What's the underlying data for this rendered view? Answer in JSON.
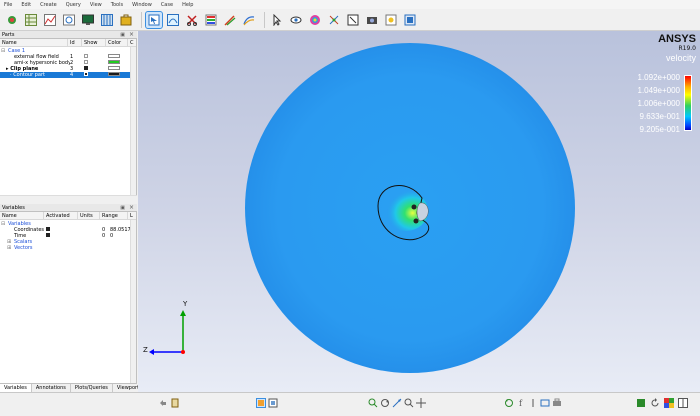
{
  "menu": [
    "File",
    "Edit",
    "Create",
    "Query",
    "View",
    "Tools",
    "Window",
    "Case",
    "Help"
  ],
  "parts_panel": {
    "title": "Parts",
    "columns": [
      "Name",
      "Id",
      "Show",
      "Color",
      "C"
    ],
    "case_label": "Case 1",
    "rows": [
      {
        "name": "external flow field",
        "id": "1",
        "show": false,
        "color": "#ffffff",
        "extra": "C"
      },
      {
        "name": "ami-x hypersonic body",
        "id": "2",
        "show": false,
        "color": "#22cc22",
        "extra": "E"
      },
      {
        "name": "Clip plane",
        "id": "3",
        "show": true,
        "color": "#ffffff",
        "extra": "C"
      },
      {
        "name": "Contour part",
        "id": "4",
        "show": true,
        "color": "#1a1a1a",
        "extra": "C"
      }
    ]
  },
  "variables_panel": {
    "title": "Variables",
    "columns": [
      "Name",
      "Activated",
      "Units",
      "Range",
      "L"
    ],
    "root_label": "Variables",
    "rows": [
      {
        "name": "Coordinates",
        "activated": true,
        "range_min": "0",
        "range_max": "88.0517",
        "extra": "N"
      },
      {
        "name": "Time",
        "activated": true,
        "range_min": "0",
        "range_max": "0",
        "extra": "C"
      }
    ],
    "groups": [
      "Scalars",
      "Vectors"
    ]
  },
  "tabs": [
    "Variables",
    "Annotations",
    "Plots/Queries",
    "Viewports"
  ],
  "viewport": {
    "brand": "ANSYS",
    "release": "R19.0",
    "legend_title": "velocity",
    "legend_labels": [
      "1.092e+000",
      "1.049e+000",
      "1.006e+000",
      "9.633e-001",
      "9.205e-001"
    ],
    "axis_labels": {
      "y": "Y",
      "z": "Z"
    }
  },
  "colors": {
    "selected_row": "#1979d6",
    "domain_disk": "#2a9af0",
    "axis_y": "#00a000",
    "axis_z": "#0000ff",
    "axis_x": "#ff0000"
  }
}
